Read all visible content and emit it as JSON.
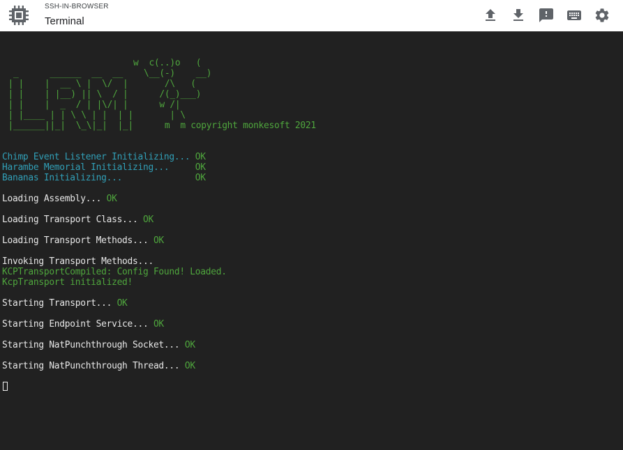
{
  "header": {
    "app_name": "SSH-IN-BROWSER",
    "title": "Terminal",
    "logo_icon": "chip-icon",
    "actions": [
      {
        "name": "upload-file",
        "icon": "upload-icon"
      },
      {
        "name": "download-file",
        "icon": "download-icon"
      },
      {
        "name": "feedback",
        "icon": "feedback-icon"
      },
      {
        "name": "keyboard",
        "icon": "keyboard-icon"
      },
      {
        "name": "settings",
        "icon": "gear-icon"
      }
    ]
  },
  "terminal": {
    "ascii_art": "                         w  c(..)o   (\n  _      ______  __  __    \\__(-)    __)\n | |    |  __ \\ |  \\/  |       /\\   (\n | |    | |__) || \\  / |      /(_)___)\n | |    |  _  / | |\\/| |      w /|\n | |____ | | \\ \\ | |  | |       | \\\n |______||_|  \\_\\|_|  |_|      m  m copyright monkesoft 2021",
    "lines": [
      {
        "text": "Chimp Event Listener Initializing... ",
        "status": "OK",
        "color": "cyan"
      },
      {
        "text": "Harambe Memorial Initializing...     ",
        "status": "OK",
        "color": "cyan"
      },
      {
        "text": "Bananas Initializing...              ",
        "status": "OK",
        "color": "cyan"
      },
      {
        "text": "",
        "status": "",
        "color": "white"
      },
      {
        "text": "Loading Assembly... ",
        "status": "OK",
        "color": "white"
      },
      {
        "text": "",
        "status": "",
        "color": "white"
      },
      {
        "text": "Loading Transport Class... ",
        "status": "OK",
        "color": "white"
      },
      {
        "text": "",
        "status": "",
        "color": "white"
      },
      {
        "text": "Loading Transport Methods... ",
        "status": "OK",
        "color": "white"
      },
      {
        "text": "",
        "status": "",
        "color": "white"
      },
      {
        "text": "Invoking Transport Methods...",
        "status": "",
        "color": "white"
      },
      {
        "text": "KCPTransportCompiled: Config Found! Loaded.",
        "status": "",
        "color": "green"
      },
      {
        "text": "KcpTransport initialized!",
        "status": "",
        "color": "green"
      },
      {
        "text": "",
        "status": "",
        "color": "white"
      },
      {
        "text": "Starting Transport... ",
        "status": "OK",
        "color": "white"
      },
      {
        "text": "",
        "status": "",
        "color": "white"
      },
      {
        "text": "Starting Endpoint Service... ",
        "status": "OK",
        "color": "white"
      },
      {
        "text": "",
        "status": "",
        "color": "white"
      },
      {
        "text": "Starting NatPunchthrough Socket... ",
        "status": "OK",
        "color": "white"
      },
      {
        "text": "",
        "status": "",
        "color": "white"
      },
      {
        "text": "Starting NatPunchthrough Thread... ",
        "status": "OK",
        "color": "white"
      }
    ],
    "colors": {
      "background": "#212121",
      "cyan": "#31a0b8",
      "green": "#4fa63d",
      "white": "#e8e8e8"
    }
  }
}
